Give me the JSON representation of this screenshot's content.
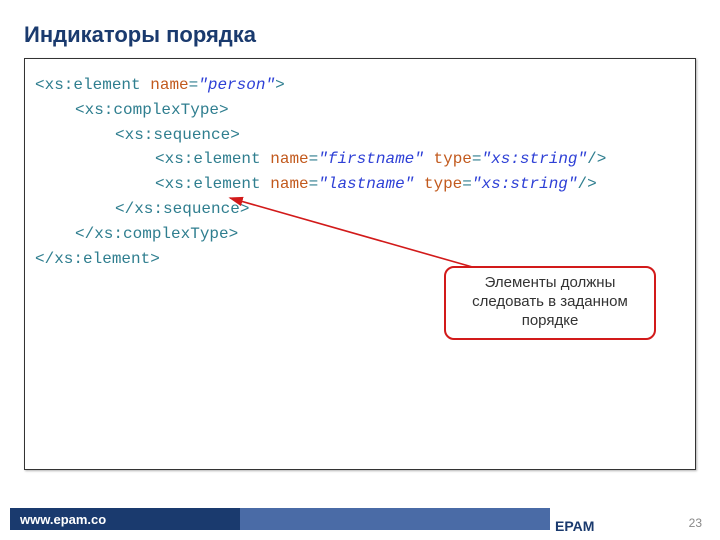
{
  "title": "Индикаторы порядка",
  "code": {
    "l1": {
      "tag_open": "<xs:element",
      "attr1": "name",
      "val1": "\"person\"",
      "close": ">"
    },
    "l2": {
      "tag": "<xs:complexType>"
    },
    "l3": {
      "tag": "<xs:sequence>"
    },
    "l4": {
      "tag_open": "<xs:element",
      "attr1": "name",
      "val1": "\"firstname\"",
      "attr2": "type",
      "val2": "\"xs:string\"",
      "close": "/>"
    },
    "l5": {
      "tag_open": "<xs:element",
      "attr1": "name",
      "val1": "\"lastname\"",
      "attr2": "type",
      "val2": "\"xs:string\"",
      "close": "/>"
    },
    "l6": {
      "tag": "</xs:sequence>"
    },
    "l7": {
      "tag": "</xs:complexType>"
    },
    "l8": {
      "tag": "</xs:element>"
    }
  },
  "callout_text": "Элементы должны следовать в заданном порядке",
  "footer_url": "www.epam.co",
  "footer_brand": "EPAM",
  "page_number": "23"
}
